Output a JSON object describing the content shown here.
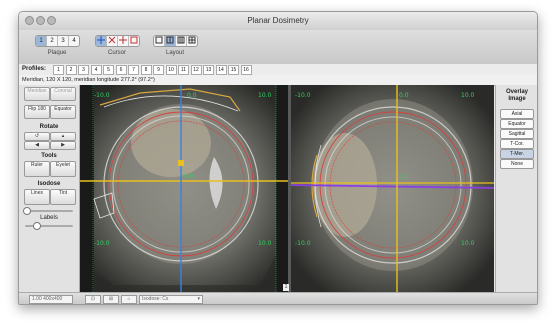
{
  "window": {
    "title": "Planar Dosimetry"
  },
  "toolbar": {
    "plaque": {
      "label": "Plaque",
      "buttons": [
        "1",
        "2",
        "3",
        "4"
      ],
      "selected": "1"
    },
    "cursor": {
      "label": "Cursor"
    },
    "layout": {
      "label": "Layout"
    }
  },
  "profiles": {
    "label": "Profiles:",
    "buttons": [
      "1",
      "2",
      "3",
      "4",
      "5",
      "6",
      "7",
      "8",
      "9",
      "10",
      "11",
      "12",
      "13",
      "14",
      "15",
      "16"
    ]
  },
  "status": {
    "text": "Meridian, 120 X 120, meridian longitude 277.2° (97.2°)"
  },
  "left_panel": {
    "view_buttons": [
      "Meridian",
      "Coronal",
      "Flip 180",
      "Equator"
    ],
    "rotate": {
      "label": "Rotate"
    },
    "tools": {
      "label": "Tools",
      "buttons": [
        "Ruler",
        "Eyelet"
      ]
    },
    "isodose": {
      "label": "Isodose",
      "buttons": [
        "Lines",
        "Tint"
      ]
    },
    "labels": {
      "label": "Labels"
    }
  },
  "viewer": {
    "left_ticks": [
      "0.0",
      "10.0",
      "-10.0",
      "-10.0",
      "0.0",
      "10.0"
    ],
    "right_ticks": [
      "0.0",
      "10.0",
      "-10.0",
      "-10.0",
      "0.0",
      "10.0"
    ],
    "page_marker": "1"
  },
  "overlay": {
    "title_line1": "Overlay",
    "title_line2": "Image",
    "options": [
      "Axial",
      "Equator",
      "Sagittal",
      "T-Cor.",
      "T-Mer.",
      "None"
    ],
    "selected": "T-Mer."
  },
  "bottom": {
    "field1": "1.00 400x400",
    "field2": "Isodose: Cs"
  },
  "colors": {
    "isodose_red": "#d44040",
    "axis_yellow": "#e8c020",
    "axis_blue": "#3a80e0",
    "axis_purple": "#8a40e0",
    "green_grid": "#30d060"
  }
}
